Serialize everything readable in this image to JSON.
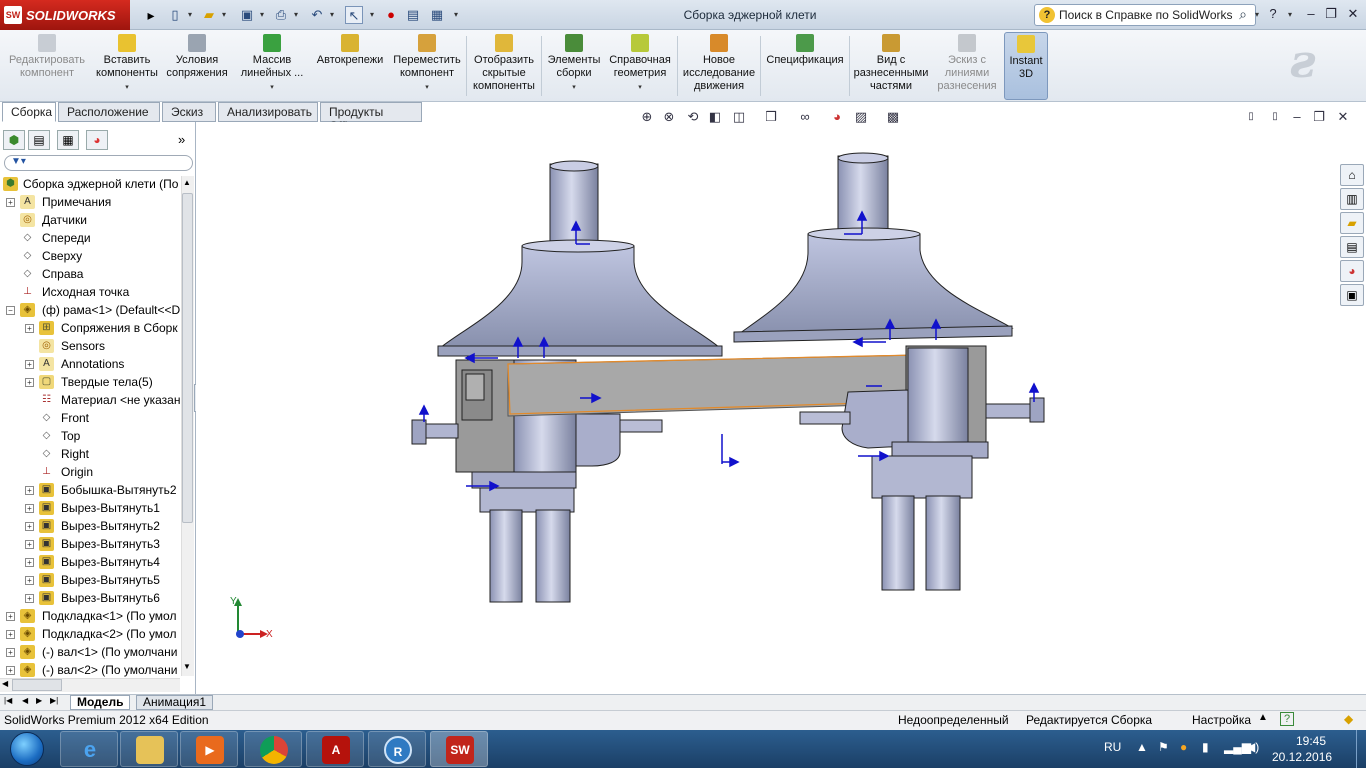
{
  "app": {
    "logo_text": "SOLIDWORKS",
    "logo_badge": "SW",
    "title": "Сборка эджерной клети"
  },
  "help": {
    "search_placeholder": "Поиск в Справке по SolidWorks"
  },
  "command_manager": {
    "items": [
      {
        "label": "Редактировать компонент",
        "disabled": true
      },
      {
        "label": "Вставить компоненты"
      },
      {
        "label": "Условия сопряжения"
      },
      {
        "label": "Массив линейных ..."
      },
      {
        "label": "Автокрепежи"
      },
      {
        "label": "Переместить компонент"
      },
      {
        "label": "Отобразить скрытые компоненты"
      },
      {
        "label": "Элементы сборки"
      },
      {
        "label": "Справочная геометрия"
      },
      {
        "label": "Новое исследование движения"
      },
      {
        "label": "Спецификация"
      },
      {
        "label": "Вид с разнесенными частями"
      },
      {
        "label": "Эскиз с линиями разнесения",
        "disabled": true
      },
      {
        "label": "Instant 3D"
      }
    ]
  },
  "tabs": [
    "Сборка",
    "Расположение",
    "Эскиз",
    "Анализировать",
    "Продукты Office"
  ],
  "tree": {
    "root": "Сборка эджерной клети  (По",
    "items": [
      {
        "label": "Примечания",
        "icon": "A"
      },
      {
        "label": "Датчики",
        "icon": "S"
      },
      {
        "label": "Спереди",
        "icon": "plane"
      },
      {
        "label": "Сверху",
        "icon": "plane"
      },
      {
        "label": "Справа",
        "icon": "plane"
      },
      {
        "label": "Исходная точка",
        "icon": "origin"
      },
      {
        "label": "(ф) рама<1> (Default<<D",
        "icon": "part"
      },
      {
        "label": "Сопряжения в Сборк",
        "icon": "mates"
      },
      {
        "label": "Sensors",
        "icon": "S"
      },
      {
        "label": "Annotations",
        "icon": "A"
      },
      {
        "label": "Твердые тела(5)",
        "icon": "bodies"
      },
      {
        "label": "Материал <не указан",
        "icon": "material"
      },
      {
        "label": "Front",
        "icon": "plane"
      },
      {
        "label": "Top",
        "icon": "plane"
      },
      {
        "label": "Right",
        "icon": "plane"
      },
      {
        "label": "Origin",
        "icon": "origin"
      },
      {
        "label": "Бобышка-Вытянуть2",
        "icon": "feature"
      },
      {
        "label": "Вырез-Вытянуть1",
        "icon": "feature"
      },
      {
        "label": "Вырез-Вытянуть2",
        "icon": "feature"
      },
      {
        "label": "Вырез-Вытянуть3",
        "icon": "feature"
      },
      {
        "label": "Вырез-Вытянуть4",
        "icon": "feature"
      },
      {
        "label": "Вырез-Вытянуть5",
        "icon": "feature"
      },
      {
        "label": "Вырез-Вытянуть6",
        "icon": "feature"
      },
      {
        "label": "Подкладка<1> (По умол",
        "icon": "part"
      },
      {
        "label": "Подкладка<2> (По умол",
        "icon": "part"
      },
      {
        "label": "(-) вал<1> (По умолчани",
        "icon": "part"
      },
      {
        "label": "(-) вал<2> (По умолчани",
        "icon": "part"
      }
    ]
  },
  "triad": {
    "x": "X",
    "y": "Y"
  },
  "bottom_tabs": [
    "Модель",
    "Анимация1"
  ],
  "status": {
    "edition": "SolidWorks Premium 2012 x64 Edition",
    "state": "Недоопределенный",
    "mode": "Редактируется Сборка",
    "settings": "Настройка"
  },
  "taskbar": {
    "lang": "RU",
    "time": "19:45",
    "date": "20.12.2016"
  },
  "colors": {
    "logo_red": "#c1251b",
    "part_body": "#b7bed8",
    "frame_gray": "#a9a9a9",
    "selection_orange": "#e28a2b",
    "arrow_blue": "#1111cc"
  }
}
